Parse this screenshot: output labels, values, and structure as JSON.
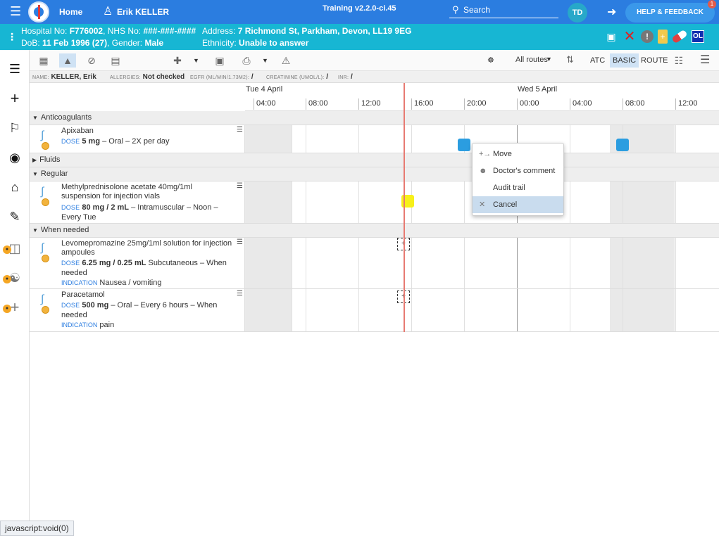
{
  "topbar": {
    "home": "Home",
    "user": "Erik KELLER",
    "training": "Training v2.2.0-ci.45",
    "search_placeholder": "Search",
    "avatar": "TD",
    "help": "HELP & FEEDBACK",
    "help_badge": "1"
  },
  "patient": {
    "hospital_label": "Hospital No:",
    "hospital_no": "F776002",
    "nhs_label": "NHS No:",
    "nhs_no": "###-###-####",
    "address_label": "Address:",
    "address": "7 Richmond St, Parkham, Devon, LL19 9EG",
    "dob_label": "DoB:",
    "dob": "11 Feb 1996 (27)",
    "gender_label": "Gender:",
    "gender": "Male",
    "ethnicity_label": "Ethnicity:",
    "ethnicity": "Unable to answer",
    "ol_badge": "OL"
  },
  "toolbar": {
    "routes": "All routes",
    "atc": "ATC",
    "basic": "BASIC",
    "route": "ROUTE"
  },
  "infobar": {
    "name_label": "NAME:",
    "name": "KELLER, Erik",
    "allergies_label": "ALLERGIES:",
    "allergies": "Not checked",
    "egfr_label": "EGFR (ML/MIN/1.73M2):",
    "egfr": "/",
    "creatinine_label": "CREATININE (UMOL/L):",
    "creatinine": "/",
    "inr_label": "INR:",
    "inr": "/"
  },
  "axis": {
    "day1": "Tue 4 April",
    "day2": "Wed 5 April",
    "ticks": [
      "04:00",
      "08:00",
      "12:00",
      "16:00",
      "20:00",
      "00:00",
      "04:00",
      "08:00",
      "12:00"
    ]
  },
  "sections": {
    "anticoagulants": "Anticoagulants",
    "fluids": "Fluids",
    "regular": "Regular",
    "when_needed": "When needed"
  },
  "drugs": {
    "dose_key": "DOSE",
    "indication_key": "INDICATION",
    "apixaban": {
      "name": "Apixaban",
      "dose": "5 mg",
      "detail": "– Oral – 2X per day"
    },
    "methylpred": {
      "name": "Methylprednisolone acetate 40mg/1ml suspension for injection vials",
      "dose": "80 mg / 2 mL",
      "detail": "– Intramuscular – Noon – Every Tue"
    },
    "levomeprom": {
      "name": "Levomepromazine 25mg/1ml solution for injection ampoules",
      "dose": "6.25 mg / 0.25 mL",
      "detail": "Subcutaneous – When needed",
      "indication": "Nausea / vomiting"
    },
    "paracetamol": {
      "name": "Paracetamol",
      "dose": "500 mg",
      "detail": "– Oral – Every 6 hours – When needed",
      "indication": "pain"
    }
  },
  "context_menu": {
    "move": "Move",
    "doctors_comment": "Doctor's comment",
    "audit_trail": "Audit trail",
    "cancel": "Cancel"
  },
  "statusbar": "javascript:void(0)",
  "colors": {
    "topbar": "#2b7de0",
    "patient_banner": "#17b6d3",
    "dose_blue": "#2b9de0",
    "dose_yellow": "#f7f01a",
    "now_line": "#e77a72"
  }
}
